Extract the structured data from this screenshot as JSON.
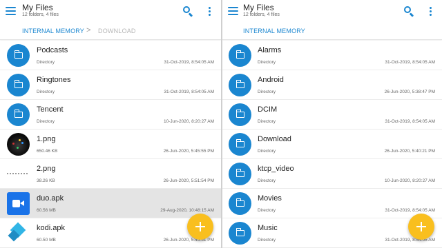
{
  "colors": {
    "accent": "#1a86d0",
    "fab": "#f9bf1e",
    "selected_row": "#e4e4e4"
  },
  "left": {
    "title": "My Files",
    "subtitle": "12 folders, 4 files",
    "breadcrumbs": [
      "INTERNAL MEMORY",
      "DOWNLOAD"
    ],
    "breadcrumb_separator": ">",
    "items": [
      {
        "name": "Podcasts",
        "meta": "Directory",
        "date": "31-Oct-2019, 8:54:05 AM",
        "icon": "folder-icon"
      },
      {
        "name": "Ringtones",
        "meta": "Directory",
        "date": "31-Oct-2019, 8:54:05 AM",
        "icon": "folder-icon"
      },
      {
        "name": "Tencent",
        "meta": "Directory",
        "date": "10-Jun-2020, 8:20:27 AM",
        "icon": "folder-icon"
      },
      {
        "name": "1.png",
        "meta": "650.46 KB",
        "date": "26-Jun-2020, 5:45:55 PM",
        "icon": "image-thumbnail"
      },
      {
        "name": "2.png",
        "meta": "38.26 KB",
        "date": "26-Jun-2020, 5:51:54 PM",
        "icon": "image-thumbnail"
      },
      {
        "name": "duo.apk",
        "meta": "60.56 MB",
        "date": "29-Aug-2020, 10:48:15 AM",
        "icon": "duo-app-icon",
        "selected": true
      },
      {
        "name": "kodi.apk",
        "meta": "60.50 MB",
        "date": "26-Jun-2020, 5:45:51 PM",
        "icon": "kodi-app-icon"
      }
    ]
  },
  "right": {
    "title": "My Files",
    "subtitle": "12 folders, 4 files",
    "breadcrumbs": [
      "INTERNAL MEMORY"
    ],
    "items": [
      {
        "name": "Alarms",
        "meta": "Directory",
        "date": "31-Oct-2019, 8:54:05 AM",
        "icon": "folder-icon"
      },
      {
        "name": "Android",
        "meta": "Directory",
        "date": "26-Jun-2020, 5:38:47 PM",
        "icon": "folder-icon"
      },
      {
        "name": "DCIM",
        "meta": "Directory",
        "date": "31-Oct-2019, 8:54:05 AM",
        "icon": "folder-icon"
      },
      {
        "name": "Download",
        "meta": "Directory",
        "date": "26-Jun-2020, 5:40:21 PM",
        "icon": "folder-icon"
      },
      {
        "name": "ktcp_video",
        "meta": "Directory",
        "date": "10-Jun-2020, 8:20:27 AM",
        "icon": "folder-icon"
      },
      {
        "name": "Movies",
        "meta": "Directory",
        "date": "31-Oct-2019, 8:54:05 AM",
        "icon": "folder-icon"
      },
      {
        "name": "Music",
        "meta": "Directory",
        "date": "31-Oct-2019, 8:54:05 AM",
        "icon": "folder-icon"
      }
    ]
  }
}
